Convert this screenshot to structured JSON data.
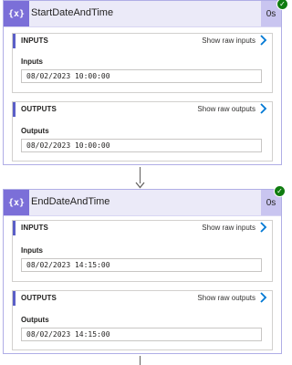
{
  "actions": [
    {
      "title": "StartDateAndTime",
      "icon": "compose-icon",
      "icon_text": "{x}",
      "duration": "0s",
      "status": "succeeded",
      "inputs_section": {
        "header": "INPUTS",
        "raw_link": "Show raw inputs",
        "field_label": "Inputs",
        "field_value": "08/02/2023 10:00:00"
      },
      "outputs_section": {
        "header": "OUTPUTS",
        "raw_link": "Show raw outputs",
        "field_label": "Outputs",
        "field_value": "08/02/2023 10:00:00"
      }
    },
    {
      "title": "EndDateAndTime",
      "icon": "compose-icon",
      "icon_text": "{x}",
      "duration": "0s",
      "status": "succeeded",
      "inputs_section": {
        "header": "INPUTS",
        "raw_link": "Show raw inputs",
        "field_label": "Inputs",
        "field_value": "08/02/2023 14:15:00"
      },
      "outputs_section": {
        "header": "OUTPUTS",
        "raw_link": "Show raw outputs",
        "field_label": "Outputs",
        "field_value": "08/02/2023 14:15:00"
      }
    }
  ],
  "colors": {
    "accent": "#5b5fc7",
    "header_bg": "#ebeaf8",
    "icon_bg": "#7b6fd8",
    "duration_bg": "#c9c5f0",
    "success": "#107c10"
  }
}
